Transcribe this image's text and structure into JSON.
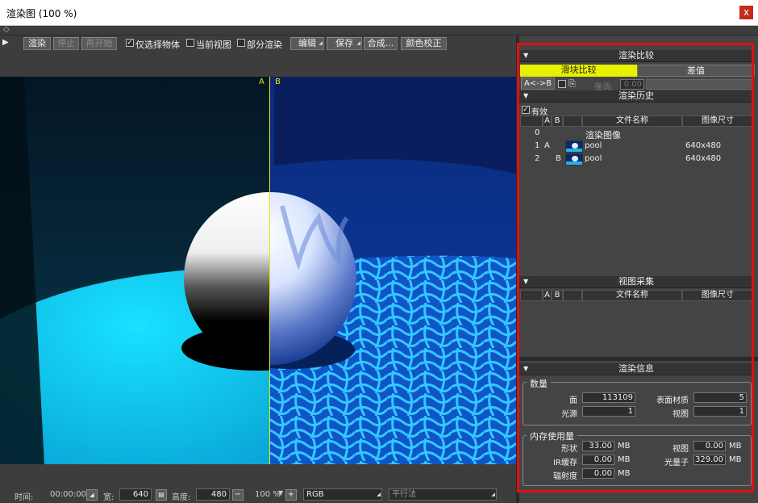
{
  "window": {
    "title": "渲染图 (100 %)",
    "close_symbol": "x"
  },
  "toolbar": {
    "render": "渲染",
    "stop": "停止",
    "restart": "再开始",
    "only_selected": "仅选择物体",
    "only_selected_checked": true,
    "current_view": "当前视图",
    "current_view_checked": false,
    "partial_render": "部分渲染",
    "partial_render_checked": false,
    "edit": "编辑",
    "save": "保存",
    "composite": "合成...",
    "color_correct": "颜色校正"
  },
  "viewport": {
    "label_a": "A",
    "label_b": "B"
  },
  "bottombar": {
    "time_label": "时间:",
    "time_value": "00:00:00",
    "width_label": "宽:",
    "width_value": "640",
    "height_label": "高度:",
    "height_value": "480",
    "minus": "−",
    "zoom": "100 %",
    "plus": "+",
    "channel": "RGB",
    "projection": "平行法"
  },
  "compare": {
    "header": "渲染比较",
    "tab_slider": "滑块比较",
    "tab_diff": "差值",
    "swap": "A<->B",
    "intensity_label": "强调:",
    "intensity_value": "0.00"
  },
  "history": {
    "header": "渲染历史",
    "valid_label": "有效",
    "valid_checked": true,
    "columns": [
      "A",
      "B",
      "文件名称",
      "图像尺寸"
    ],
    "rows": [
      {
        "index": "0",
        "a": "",
        "b": "",
        "name": "渲染图像",
        "size": "",
        "thumb": false
      },
      {
        "index": "1",
        "a": "A",
        "b": "",
        "name": "pool",
        "size": "640x480",
        "thumb": true
      },
      {
        "index": "2",
        "a": "",
        "b": "B",
        "name": "pool",
        "size": "640x480",
        "thumb": true
      }
    ]
  },
  "snapshots": {
    "header": "视图采集",
    "columns": [
      "A",
      "B",
      "文件名称",
      "图像尺寸"
    ]
  },
  "info": {
    "header": "渲染信息",
    "count_group": "数量",
    "faces_label": "面",
    "faces_value": "113109",
    "materials_label": "表面材质",
    "materials_value": "5",
    "lights_label": "光源",
    "lights_value": "1",
    "views_label": "视图",
    "views_value": "1",
    "memory_group": "内存使用量",
    "shapes_label": "形状",
    "shapes_value": "33.00",
    "view_mem_label": "视图",
    "view_mem_value": "0.00",
    "ir_label": "IR缓存",
    "ir_value": "0.00",
    "photon_label": "光量子",
    "photon_value": "329.00",
    "radiance_label": "辐射度",
    "radiance_value": "0.00",
    "unit": "MB"
  },
  "colors": {
    "highlight_tab": "#e8f000",
    "annotation_box": "#e01010",
    "split_line": "#e8e800"
  }
}
